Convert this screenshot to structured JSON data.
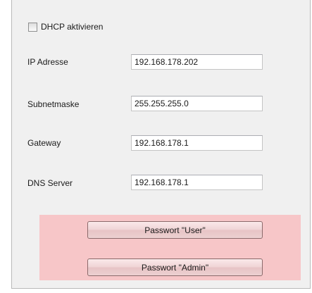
{
  "dhcp": {
    "label": "DHCP aktivieren",
    "checked": false
  },
  "fields": [
    {
      "label": "IP Adresse",
      "value": "192.168.178.202"
    },
    {
      "label": "Subnetmaske",
      "value": "255.255.255.0"
    },
    {
      "label": "Gateway",
      "value": "192.168.178.1"
    },
    {
      "label": "DNS Server",
      "value": "192.168.178.1"
    }
  ],
  "buttons": {
    "password_user": "Passwort \"User\"",
    "password_admin": "Passwort \"Admin\""
  },
  "colors": {
    "panel_background": "#f0f0f0",
    "password_area": "#f7c6c8"
  }
}
